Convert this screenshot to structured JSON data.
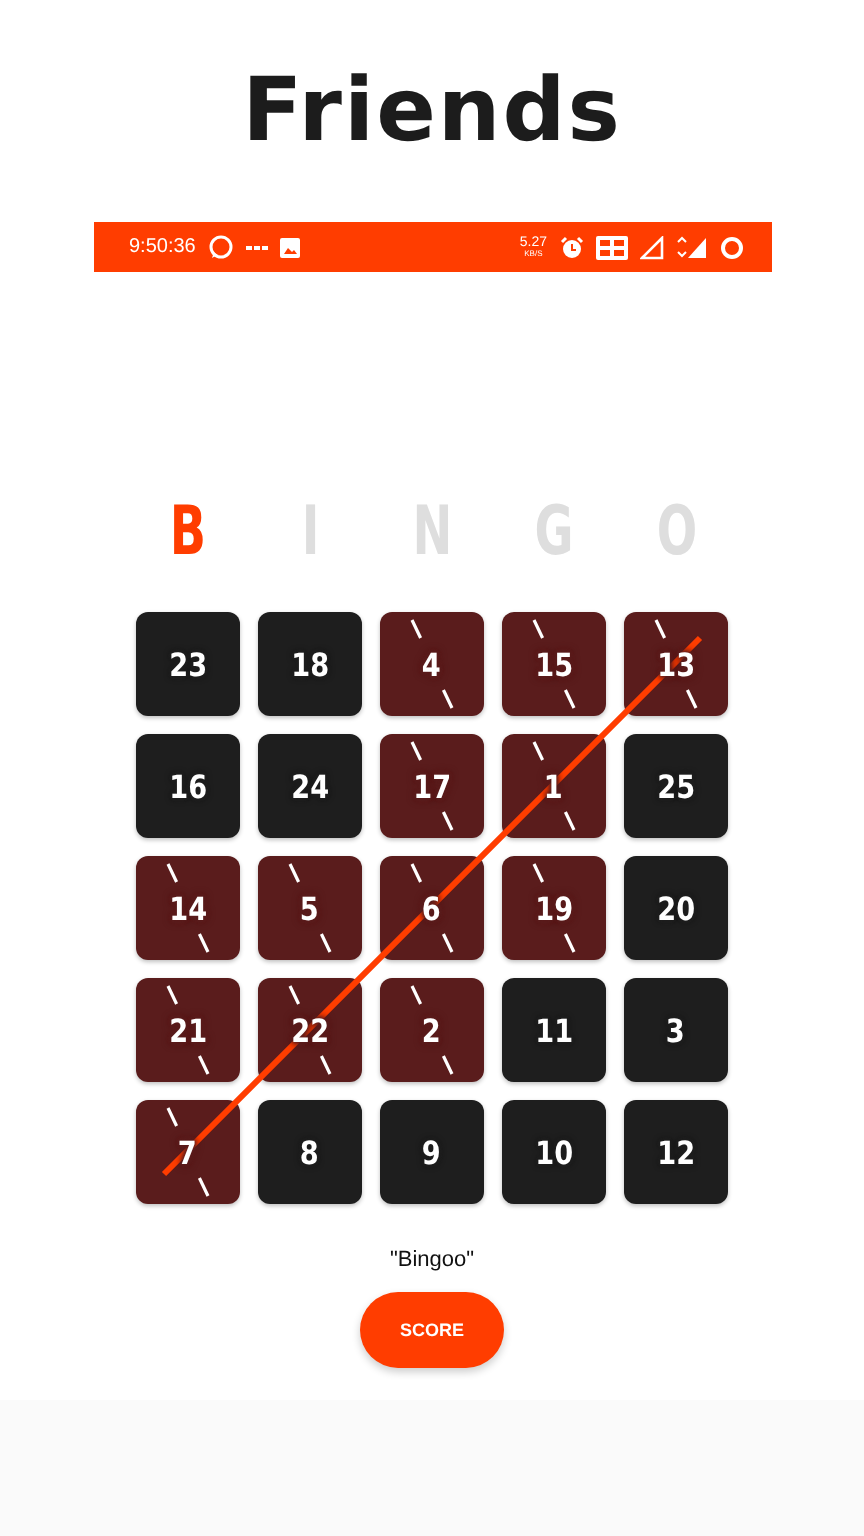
{
  "title": "Friends",
  "status_bar": {
    "time": "9:50:36",
    "speed": "5.27",
    "speed_unit": "KB/S"
  },
  "letters": [
    {
      "text": "B",
      "on": true
    },
    {
      "text": "I",
      "on": false
    },
    {
      "text": "N",
      "on": false
    },
    {
      "text": "G",
      "on": false
    },
    {
      "text": "O",
      "on": false
    }
  ],
  "board": {
    "win_line": {
      "kind": "anti-diagonal"
    },
    "cells": [
      {
        "number": "23",
        "marked": false
      },
      {
        "number": "18",
        "marked": false
      },
      {
        "number": "4",
        "marked": true
      },
      {
        "number": "15",
        "marked": true
      },
      {
        "number": "13",
        "marked": true
      },
      {
        "number": "16",
        "marked": false
      },
      {
        "number": "24",
        "marked": false
      },
      {
        "number": "17",
        "marked": true
      },
      {
        "number": "1",
        "marked": true
      },
      {
        "number": "25",
        "marked": false
      },
      {
        "number": "14",
        "marked": true
      },
      {
        "number": "5",
        "marked": true
      },
      {
        "number": "6",
        "marked": true
      },
      {
        "number": "19",
        "marked": true
      },
      {
        "number": "20",
        "marked": false
      },
      {
        "number": "21",
        "marked": true
      },
      {
        "number": "22",
        "marked": true
      },
      {
        "number": "2",
        "marked": true
      },
      {
        "number": "11",
        "marked": false
      },
      {
        "number": "3",
        "marked": false
      },
      {
        "number": "7",
        "marked": true
      },
      {
        "number": "8",
        "marked": false
      },
      {
        "number": "9",
        "marked": false
      },
      {
        "number": "10",
        "marked": false
      },
      {
        "number": "12",
        "marked": false
      }
    ]
  },
  "message": "\"Bingoo\"",
  "button": "SCORE"
}
